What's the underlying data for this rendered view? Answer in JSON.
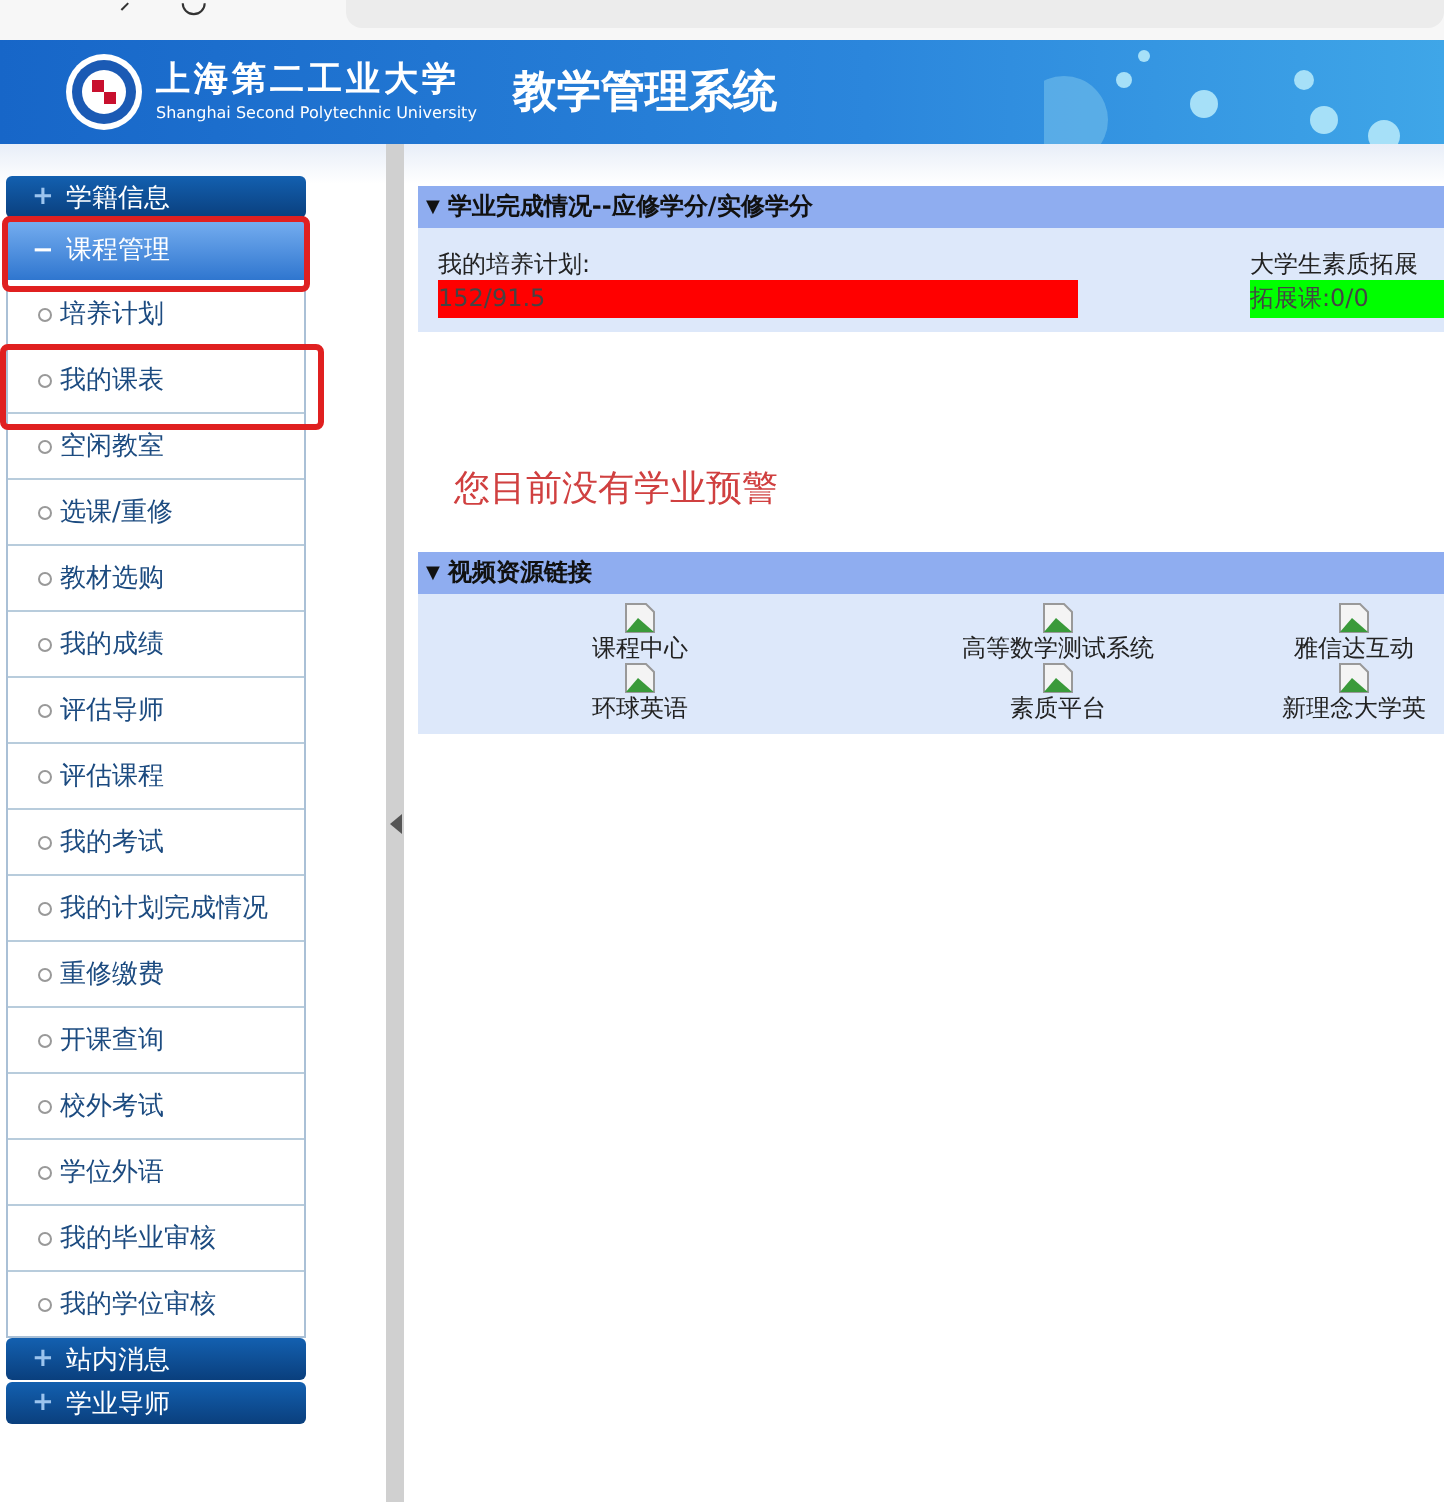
{
  "header": {
    "school_cn": "上海第二工业大学",
    "school_en": "Shanghai Second Polytechnic University",
    "system_title": "教学管理系统"
  },
  "sidebar": {
    "groups": [
      {
        "sign": "+",
        "label": "学籍信息",
        "expanded": false,
        "highlighted": false
      },
      {
        "sign": "−",
        "label": "课程管理",
        "expanded": true,
        "highlighted": true,
        "items": [
          {
            "label": "培养计划",
            "highlighted": false
          },
          {
            "label": "我的课表",
            "highlighted": true
          },
          {
            "label": "空闲教室",
            "highlighted": false
          },
          {
            "label": "选课/重修",
            "highlighted": false
          },
          {
            "label": "教材选购",
            "highlighted": false
          },
          {
            "label": "我的成绩",
            "highlighted": false
          },
          {
            "label": "评估导师",
            "highlighted": false
          },
          {
            "label": "评估课程",
            "highlighted": false
          },
          {
            "label": "我的考试",
            "highlighted": false
          },
          {
            "label": "我的计划完成情况",
            "highlighted": false
          },
          {
            "label": "重修缴费",
            "highlighted": false
          },
          {
            "label": "开课查询",
            "highlighted": false
          },
          {
            "label": "校外考试",
            "highlighted": false
          },
          {
            "label": "学位外语",
            "highlighted": false
          },
          {
            "label": "我的毕业审核",
            "highlighted": false
          },
          {
            "label": "我的学位审核",
            "highlighted": false
          }
        ]
      },
      {
        "sign": "+",
        "label": "站内消息",
        "expanded": false,
        "highlighted": false
      },
      {
        "sign": "+",
        "label": "学业导师",
        "expanded": false,
        "highlighted": false
      }
    ]
  },
  "progress_section": {
    "toggle": "▼",
    "title": "学业完成情况--应修学分/实修学分",
    "items": [
      {
        "label": "我的培养计划:",
        "value": "152/91.5",
        "color": "#ff0000"
      },
      {
        "label": "大学生素质拓展",
        "value": "拓展课:0/0",
        "color": "#00ff00"
      }
    ]
  },
  "warning": "您目前没有学业预警",
  "video_section": {
    "toggle": "▼",
    "title": "视频资源链接",
    "links": [
      {
        "label": "课程中心"
      },
      {
        "label": "高等数学测试系统"
      },
      {
        "label": "雅信达互动"
      },
      {
        "label": "环球英语"
      },
      {
        "label": "素质平台"
      },
      {
        "label": "新理念大学英"
      }
    ]
  }
}
